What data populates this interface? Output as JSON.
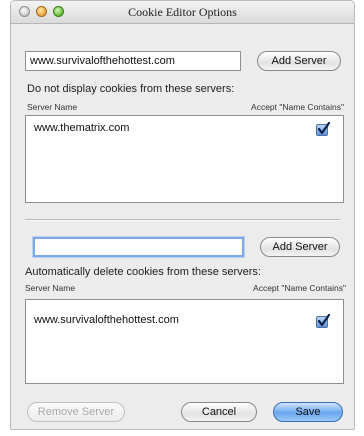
{
  "window": {
    "title": "Cookie Editor Options"
  },
  "top_section": {
    "server_field_value": "www.survivalofthehottest.com",
    "add_button_label": "Add Server",
    "heading": "Do not display cookies from these servers:",
    "columns": {
      "server_name": "Server Name",
      "accept": "Accept \"Name Contains\""
    },
    "rows": [
      {
        "server": "www.thematrix.com",
        "checked": true
      }
    ]
  },
  "bottom_section": {
    "server_field_value": "",
    "add_button_label": "Add Server",
    "heading": "Automatically delete cookies from these servers:",
    "columns": {
      "server_name": "Server Name",
      "accept": "Accept \"Name Contains\""
    },
    "rows": [
      {
        "server": "www.survivalofthehottest.com",
        "checked": true
      }
    ]
  },
  "footer": {
    "remove_label": "Remove Server",
    "cancel_label": "Cancel",
    "save_label": "Save"
  }
}
